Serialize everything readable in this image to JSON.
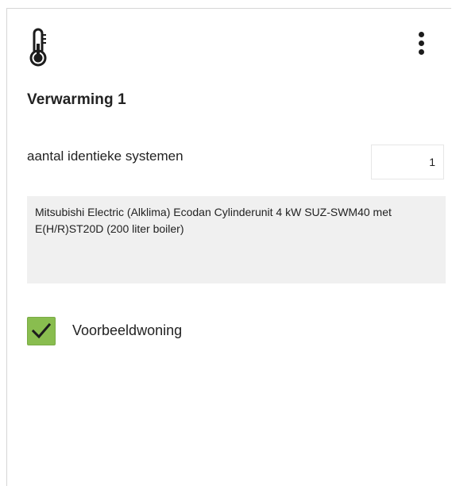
{
  "card": {
    "icon": "thermometer-icon",
    "menu_icon": "more-vertical-icon",
    "title": "Verwarming 1",
    "count": {
      "label": "aantal identieke systemen",
      "value": "1"
    },
    "description": "Mitsubishi Electric (Alklima) Ecodan Cylinderunit 4 kW SUZ-SWM40 met E(H/R)ST20D (200 liter boiler)",
    "checkbox": {
      "label": "Voorbeeldwoning",
      "checked": true,
      "color": "#89bd4f"
    }
  }
}
